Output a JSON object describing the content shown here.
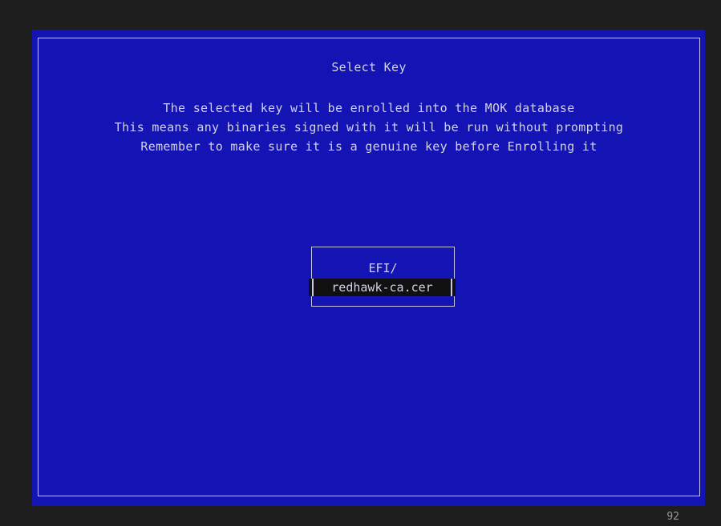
{
  "dialog": {
    "title": "Select Key",
    "message_lines": [
      "The selected key will be enrolled into the MOK database",
      "This means any binaries signed with it will be run without prompting",
      "Remember to make sure it is a genuine key before Enrolling it"
    ]
  },
  "file_menu": {
    "items": [
      {
        "label": "EFI/",
        "selected": false
      },
      {
        "label": "redhawk-ca.cer",
        "selected": true
      }
    ]
  },
  "footer": {
    "page_number": "92"
  },
  "colors": {
    "screen_background": "#1414b4",
    "outer_background": "#1e1e1e",
    "text": "#d2d2e4",
    "selection_background": "#101010"
  }
}
